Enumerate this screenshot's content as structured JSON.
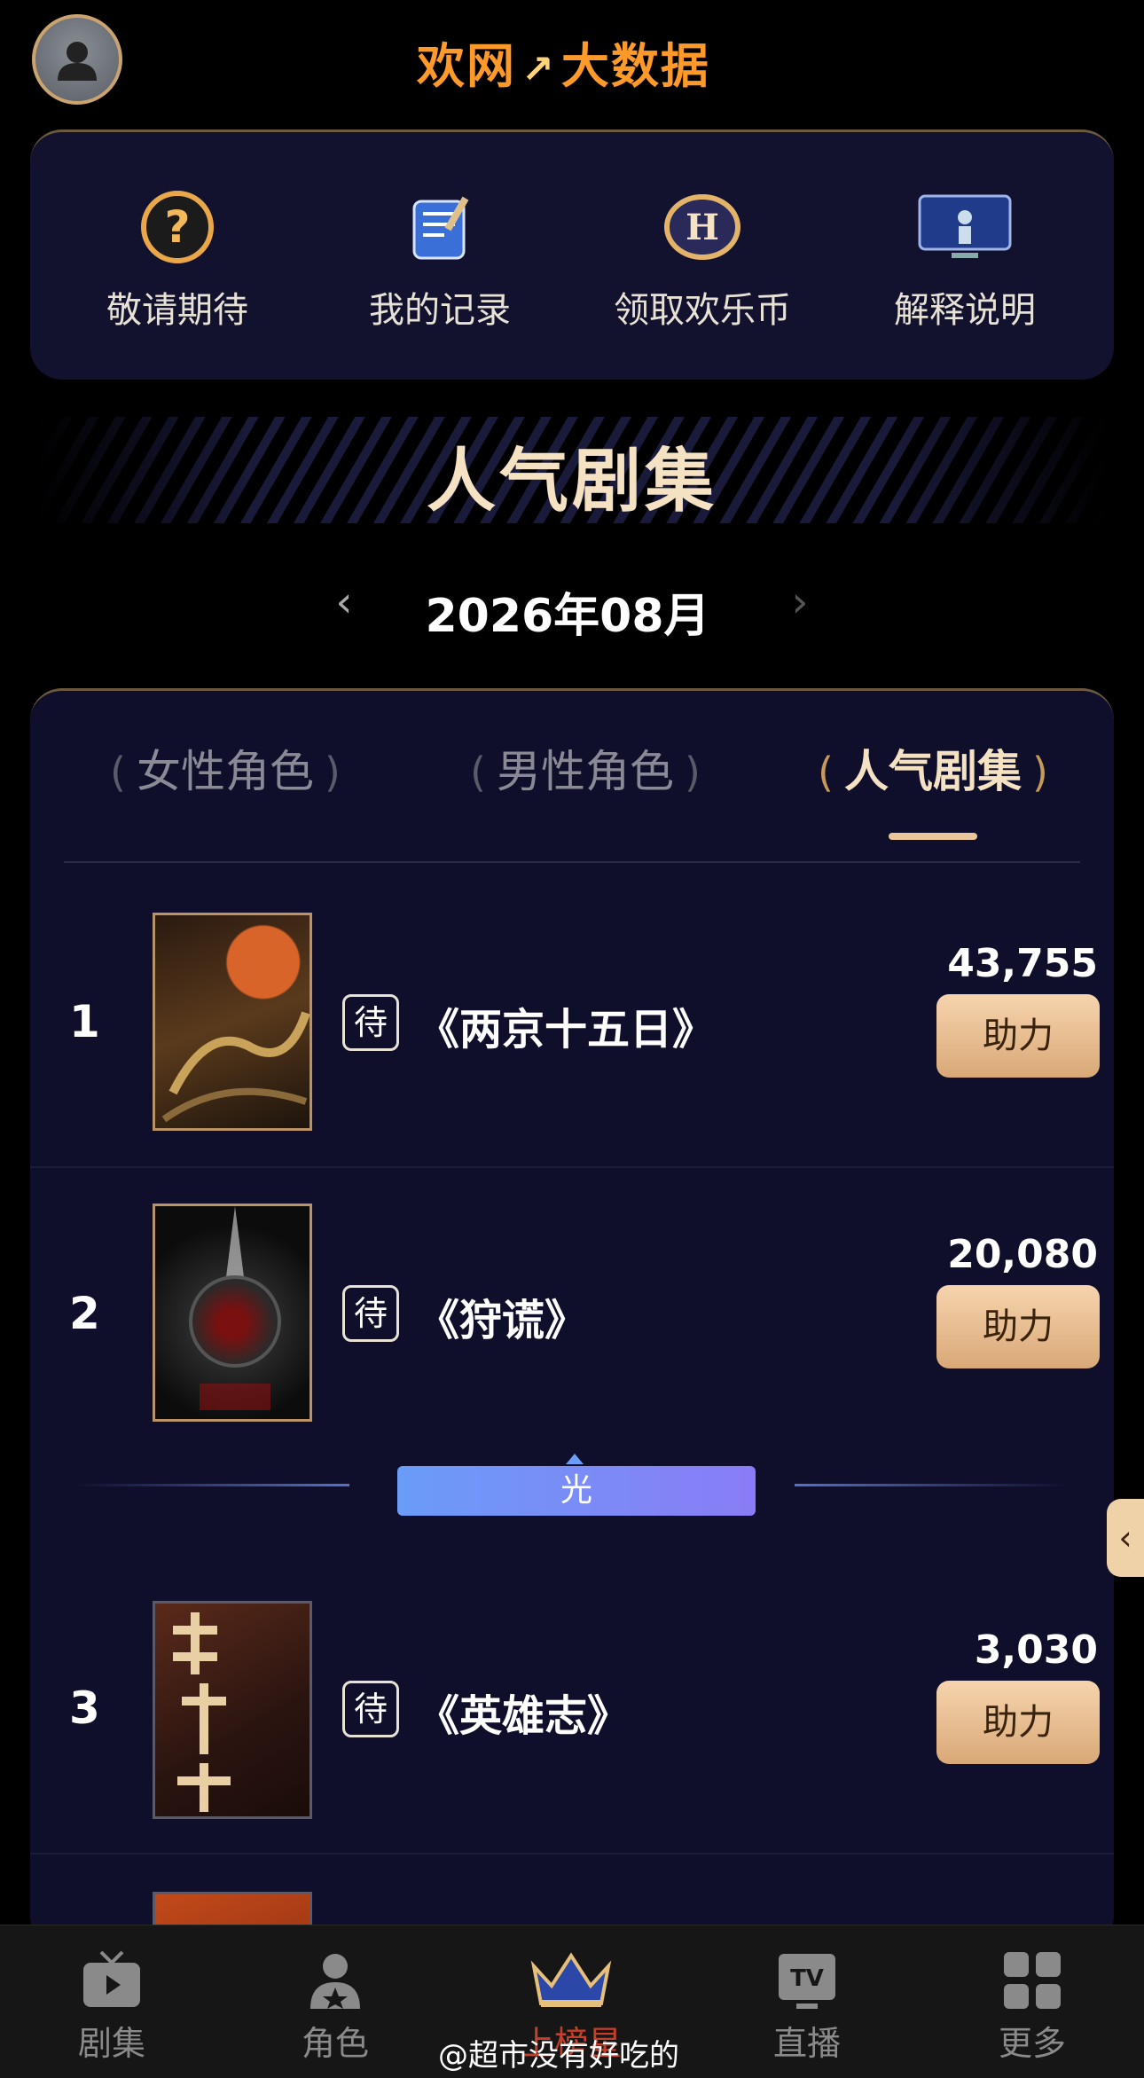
{
  "header": {
    "logo_text": "欢网",
    "logo_slash": "↗",
    "logo_text2": "大数据"
  },
  "quick_menu": [
    {
      "label": "敬请期待",
      "icon": "question-icon"
    },
    {
      "label": "我的记录",
      "icon": "notebook-icon"
    },
    {
      "label": "领取欢乐币",
      "icon": "coin-icon"
    },
    {
      "label": "解释说明",
      "icon": "monitor-icon"
    }
  ],
  "section": {
    "title": "人气剧集"
  },
  "month": {
    "label": "2026年08月",
    "prev": "‹",
    "next": "›"
  },
  "tabs": [
    {
      "label": "女性角色",
      "active": false
    },
    {
      "label": "男性角色",
      "active": false
    },
    {
      "label": "人气剧集",
      "active": true
    }
  ],
  "ranking": [
    {
      "rank": "1",
      "badge": "待",
      "title": "《两京十五日》",
      "count": "43,755",
      "button": "助力"
    },
    {
      "rank": "2",
      "badge": "待",
      "title": "《狩谎》",
      "count": "20,080",
      "button": "助力"
    },
    {
      "rank": "3",
      "badge": "待",
      "title": "《英雄志》",
      "count": "3,030",
      "button": "助力"
    }
  ],
  "separator": {
    "label": "光"
  },
  "side_tab": {
    "label": "‹"
  },
  "bottom_nav": [
    {
      "label": "剧集",
      "icon": "tv-play-icon",
      "active": false
    },
    {
      "label": "角色",
      "icon": "role-icon",
      "active": false
    },
    {
      "label": "上榜星",
      "icon": "crown-icon",
      "active": true
    },
    {
      "label": "直播",
      "icon": "tv-live-icon",
      "active": false
    },
    {
      "label": "更多",
      "icon": "grid-icon",
      "active": false
    }
  ],
  "watermark": "@超市没有好吃的",
  "colors": {
    "accent": "#e9c79a",
    "card_bg": "#12122e",
    "boost_button": "#e2b386",
    "logo": "#ff9a2a"
  }
}
